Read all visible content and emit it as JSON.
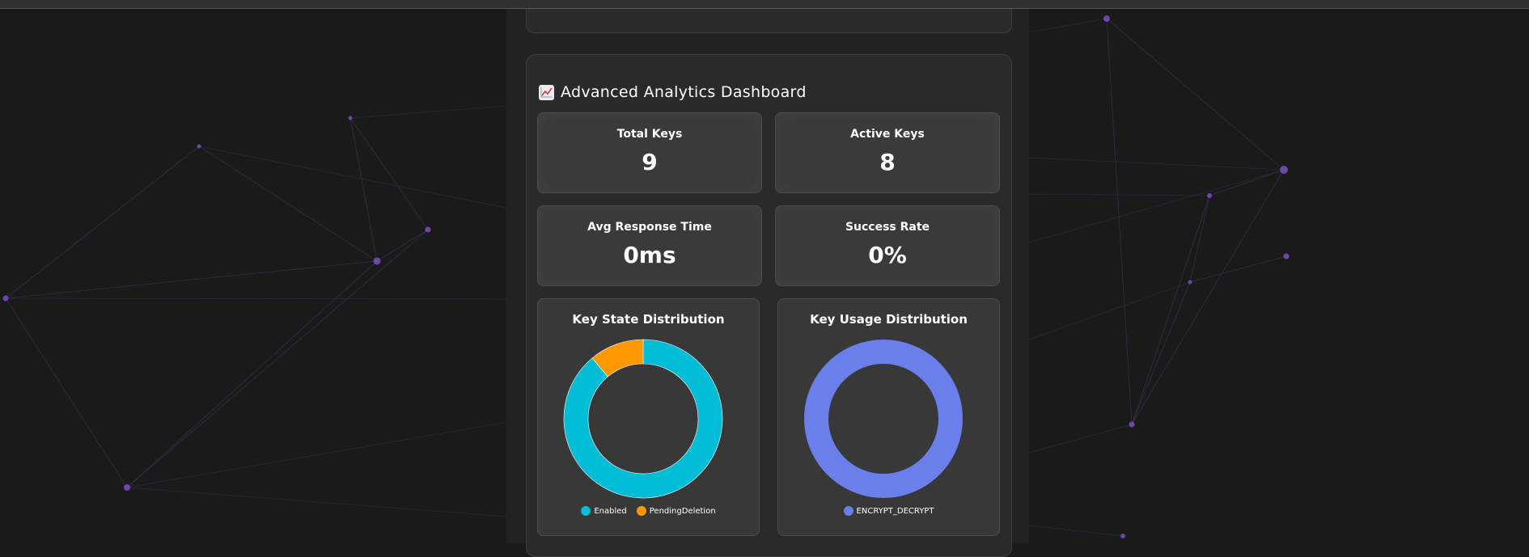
{
  "dashboard": {
    "title": "Advanced Analytics Dashboard",
    "icon": "chart-increasing-icon"
  },
  "stats": [
    {
      "label": "Total Keys",
      "value": "9"
    },
    {
      "label": "Active Keys",
      "value": "8"
    },
    {
      "label": "Avg Response Time",
      "value": "0ms"
    },
    {
      "label": "Success Rate",
      "value": "0%"
    }
  ],
  "colors": {
    "enabled": "#00bcd4",
    "pending_deletion": "#ff9800",
    "encrypt_decrypt": "#6a7fea",
    "background": "#1a1a1a",
    "network_node": "#7b4fc0"
  },
  "chart_data": [
    {
      "type": "pie",
      "title": "Key State Distribution",
      "categories": [
        "Enabled",
        "PendingDeletion"
      ],
      "values": [
        8,
        1
      ],
      "legend": "bottom"
    },
    {
      "type": "pie",
      "title": "Key Usage Distribution",
      "categories": [
        "ENCRYPT_DECRYPT"
      ],
      "values": [
        9
      ],
      "legend": "bottom"
    }
  ]
}
